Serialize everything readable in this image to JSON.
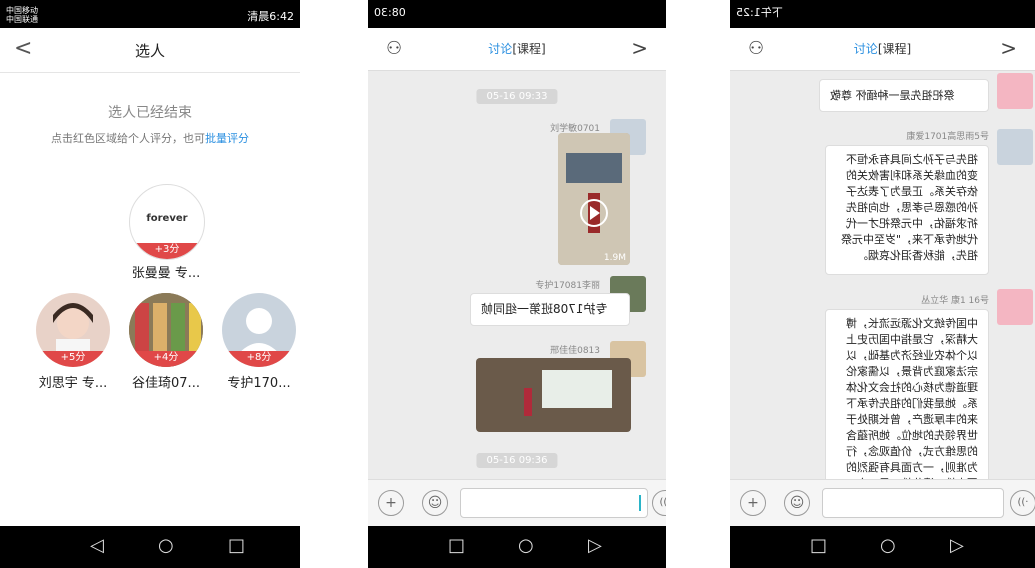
{
  "p1": {
    "status_left": "中国移动\n中国联通",
    "status_right": "清晨6:42",
    "back": "<",
    "title": "选人",
    "ended": "选人已经结束",
    "hint_prefix": "点击红色区域给个人评分，也可",
    "hint_link": "批量评分",
    "students": [
      {
        "name": "张曼曼 专...",
        "score": "+3分"
      },
      {
        "name": "刘思宇 专...",
        "score": "+5分"
      },
      {
        "name": "谷佳琦07...",
        "score": "+4分"
      },
      {
        "name": "专护170...",
        "score": "+8分"
      }
    ]
  },
  "p2": {
    "status_left": "08:30",
    "header_tag": "[课程]",
    "header_title": "讨论",
    "times": [
      "05-16 09:33",
      "05-16 09:36"
    ],
    "users": [
      "刘学敏0701",
      "专护17081李丽",
      "邢佳佳0813"
    ],
    "video_size": "1.9M",
    "message": "专护1708班第一组同帧"
  },
  "p3": {
    "status_left": "下午1:25",
    "header_tag": "[课程]",
    "header_title": "讨论",
    "msg1": "祭祀祖先是一种缅怀  尊敬",
    "user2": "康爱1701高思雨5号",
    "msg2": "祖先与子孙之间具有永恒不变的血缘关系和利害攸关的依存关系。正是为了表达子孙的感恩与孝思，也向祖先祈求福佑，中元祭祀才一代代地传承下来，\"岁至中元祭祖先，能秋香泪化哀烟。",
    "user3": "丛立华 康1 16号",
    "msg3": "中国传统文化源远流长，博大精深，它是指中国历史上以个体农业经济为基础，以宗法家庭为背景，以儒家伦理道德为核心的社会文化体系。她是我们的祖先传承下来的丰厚遗产，曾长期处于世界领先的地位。她所蕴含的思维方式，价值观念，行为准则，一方面具有强烈的历史性，遗传性；另一方"
  },
  "nav": {
    "back": "◁",
    "home": "○",
    "recent": "□"
  }
}
